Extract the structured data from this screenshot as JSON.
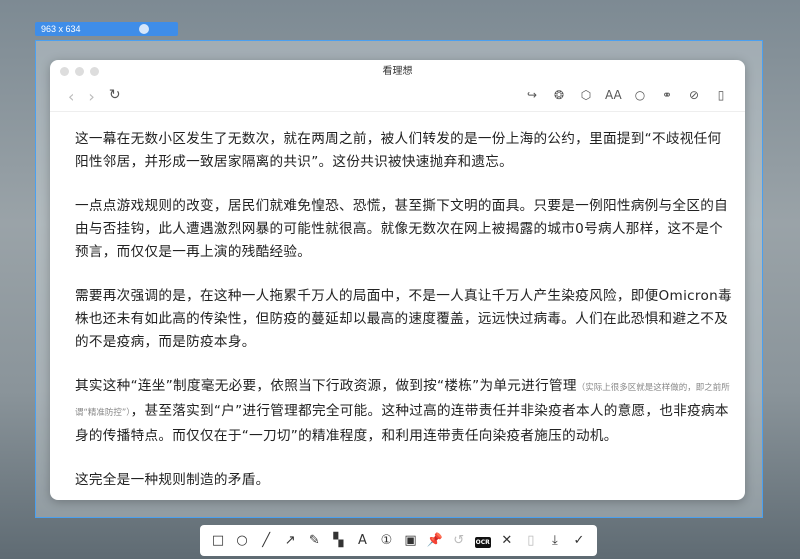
{
  "capture": {
    "size_label": "963 x 634"
  },
  "window": {
    "title": "看理想"
  },
  "nav": {
    "icons": [
      "back-icon",
      "forward-icon",
      "reload-icon",
      "share-icon",
      "aperture-icon",
      "cube-icon",
      "font-size-icon",
      "chat-icon",
      "link-icon",
      "compass-icon",
      "device-icon"
    ]
  },
  "article": {
    "p1": "这一幕在无数小区发生了无数次，就在两周之前，被人们转发的是一份上海的公约，里面提到“不歧视任何阳性邻居，并形成一致居家隔离的共识”。这份共识被快速抛弃和遗忘。",
    "p2": "一点点游戏规则的改变，居民们就难免惶恐、恐慌，甚至撕下文明的面具。只要是一例阳性病例与全区的自由与否挂钩，此人遭遇激烈网暴的可能性就很高。就像无数次在网上被揭露的城市0号病人那样，这不是个预言，而仅仅是一再上演的残酷经验。",
    "p3": "需要再次强调的是，在这种一人拖累千万人的局面中，不是一人真让千万人产生染疫风险，即便Omicron毒株也还未有如此高的传染性，但防疫的蔓延却以最高的速度覆盖，远远快过病毒。人们在此恐惧和避之不及的不是疫病，而是防疫本身。",
    "p4a": "其实这种“连坐”制度毫无必要，依照当下行政资源，做到按“楼栋”为单元进行管理",
    "p4note": "（实际上很多区就是这样做的，即之前所谓“精准防控”）",
    "p4b": "，甚至落实到“户”进行管理都完全可能。这种过高的连带责任并非染疫者本人的意愿，也非疫病本身的传播特点。而仅仅在于“一刀切”的精准程度，和利用连带责任向染疫者施压的动机。",
    "p5": "这完全是一种规则制造的矛盾。"
  },
  "toolbar": {
    "ocr_label": "OCR"
  }
}
